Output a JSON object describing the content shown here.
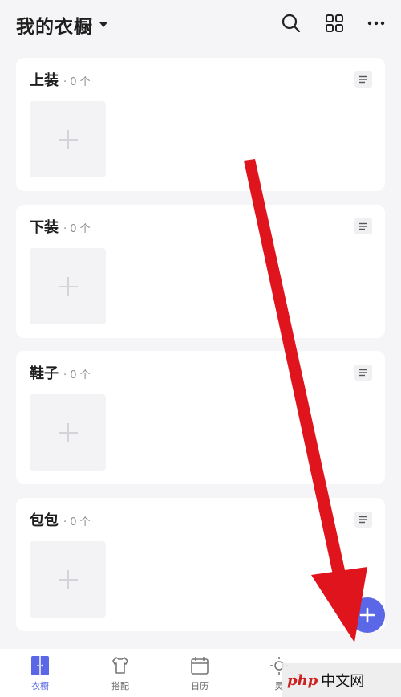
{
  "header": {
    "title": "我的衣橱"
  },
  "categories": [
    {
      "name": "上装",
      "count": "· 0 个"
    },
    {
      "name": "下装",
      "count": "· 0 个"
    },
    {
      "name": "鞋子",
      "count": "· 0 个"
    },
    {
      "name": "包包",
      "count": "· 0 个"
    }
  ],
  "tabs": [
    {
      "label": "衣橱",
      "icon": "wardrobe-icon",
      "active": true
    },
    {
      "label": "搭配",
      "icon": "outfit-icon"
    },
    {
      "label": "日历",
      "icon": "calendar-icon"
    },
    {
      "label": "灵",
      "icon": "inspiration-icon"
    }
  ],
  "watermark": {
    "brand": "php",
    "text": "中文网"
  },
  "colors": {
    "accent": "#5a67e6",
    "background": "#f5f5f7",
    "arrow": "#e0141c"
  }
}
